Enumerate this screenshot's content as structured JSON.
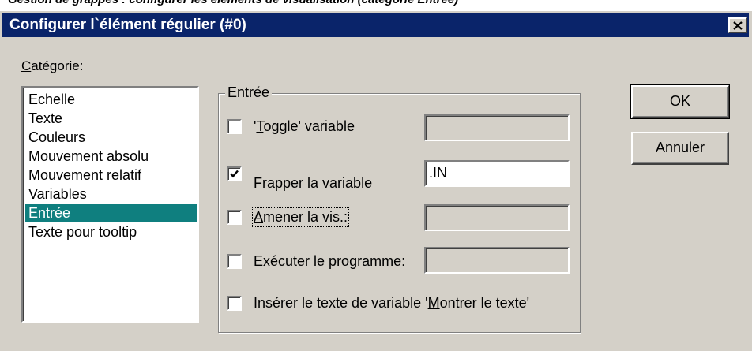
{
  "caption": "Gestion de grappes : configurer les éléments de visualisation (catégorie Entrée)",
  "window": {
    "title": "Configurer l`élément régulier (#0)"
  },
  "category": {
    "label": "Catégorie:",
    "items": [
      "Echelle",
      "Texte",
      "Couleurs",
      "Mouvement absolu",
      "Mouvement relatif",
      "Variables",
      "Entrée",
      "Texte pour tooltip"
    ],
    "selected": "Entrée"
  },
  "input_group": {
    "title": "Entrée",
    "options": [
      {
        "label_pre": "'",
        "label_key": "T",
        "label_post": "oggle' variable",
        "checked": false,
        "field_value": "",
        "field_enabled": false
      },
      {
        "label_pre": "Frapper la ",
        "label_key": "v",
        "label_post": "ariable",
        "checked": true,
        "field_value": ".IN",
        "field_enabled": true
      },
      {
        "label_pre": "",
        "label_key": "A",
        "label_post": "mener la vis.:",
        "checked": false,
        "field_value": "",
        "field_enabled": false
      },
      {
        "label_pre": "Exécuter le ",
        "label_key": "p",
        "label_post": "rogramme:",
        "checked": false,
        "field_value": "",
        "field_enabled": false
      },
      {
        "label_pre": "Insérer le texte de variable '",
        "label_key": "M",
        "label_post": "ontrer le texte'",
        "checked": false
      }
    ]
  },
  "buttons": {
    "ok": "OK",
    "cancel": "Annuler"
  }
}
